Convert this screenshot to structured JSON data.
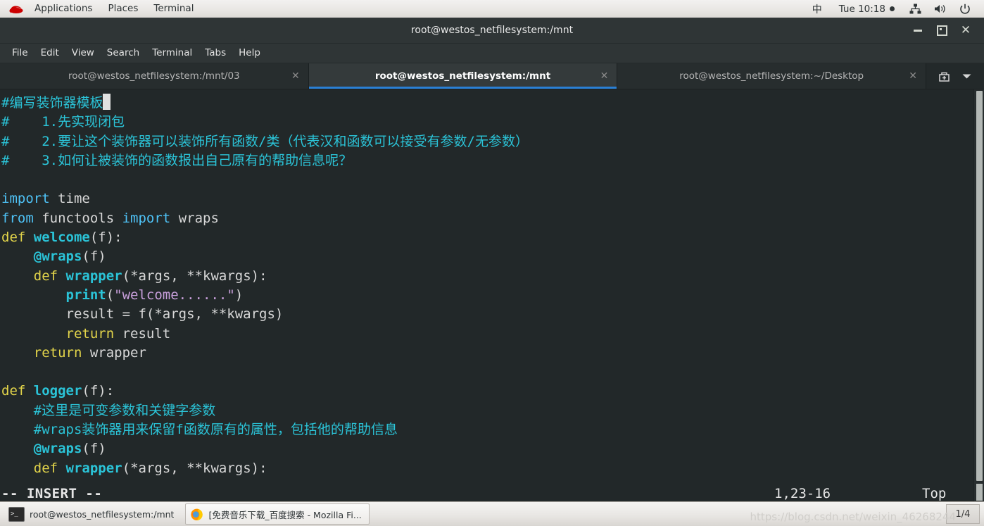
{
  "top_panel": {
    "logo_icon": "redhat-logo-icon",
    "menus": [
      "Applications",
      "Places",
      "Terminal"
    ],
    "ime": "中",
    "clock": "Tue 10:18",
    "icons": [
      "network-icon",
      "volume-icon",
      "power-icon"
    ]
  },
  "window": {
    "title": "root@westos_netfilesystem:/mnt",
    "controls": {
      "minimize": "minimize-icon",
      "maximize": "maximize-icon",
      "close": "close-icon"
    },
    "menubar": [
      "File",
      "Edit",
      "View",
      "Search",
      "Terminal",
      "Tabs",
      "Help"
    ],
    "tabs": [
      {
        "label": "root@westos_netfilesystem:/mnt/03",
        "active": false
      },
      {
        "label": "root@westos_netfilesystem:/mnt",
        "active": true
      },
      {
        "label": "root@westos_netfilesystem:~/Desktop",
        "active": false
      }
    ],
    "tab_actions": {
      "new_tab": "new-tab-icon",
      "tab_list": "chevron-down-icon"
    }
  },
  "terminal": {
    "lines": [
      [
        {
          "t": "#编写装饰器模板",
          "c": "c-comment"
        },
        {
          "t": "",
          "c": "cursor"
        }
      ],
      [
        {
          "t": "#    1.先实现闭包",
          "c": "c-comment"
        }
      ],
      [
        {
          "t": "#    2.要让这个装饰器可以装饰所有函数/类（代表汉和函数可以接受有参数/无参数）",
          "c": "c-comment"
        }
      ],
      [
        {
          "t": "#    3.如何让被装饰的函数报出自己原有的帮助信息呢？",
          "c": "c-comment"
        }
      ],
      [
        {
          "t": "",
          "c": "c-plain"
        }
      ],
      [
        {
          "t": "import",
          "c": "c-keyword"
        },
        {
          "t": " time",
          "c": "c-plain"
        }
      ],
      [
        {
          "t": "from",
          "c": "c-keyword"
        },
        {
          "t": " functools ",
          "c": "c-plain"
        },
        {
          "t": "import",
          "c": "c-keyword"
        },
        {
          "t": " wraps",
          "c": "c-plain"
        }
      ],
      [
        {
          "t": "def",
          "c": "c-def"
        },
        {
          "t": " ",
          "c": "c-plain"
        },
        {
          "t": "welcome",
          "c": "c-fn"
        },
        {
          "t": "(f):",
          "c": "c-plain"
        }
      ],
      [
        {
          "t": "    ",
          "c": "c-plain"
        },
        {
          "t": "@wraps",
          "c": "c-fn"
        },
        {
          "t": "(f)",
          "c": "c-plain"
        }
      ],
      [
        {
          "t": "    ",
          "c": "c-plain"
        },
        {
          "t": "def",
          "c": "c-def"
        },
        {
          "t": " ",
          "c": "c-plain"
        },
        {
          "t": "wrapper",
          "c": "c-fn"
        },
        {
          "t": "(*args, **kwargs):",
          "c": "c-plain"
        }
      ],
      [
        {
          "t": "        ",
          "c": "c-plain"
        },
        {
          "t": "print",
          "c": "c-fn"
        },
        {
          "t": "(",
          "c": "c-plain"
        },
        {
          "t": "\"welcome......\"",
          "c": "c-str"
        },
        {
          "t": ")",
          "c": "c-plain"
        }
      ],
      [
        {
          "t": "        result = f(*args, **kwargs)",
          "c": "c-plain"
        }
      ],
      [
        {
          "t": "        ",
          "c": "c-plain"
        },
        {
          "t": "return",
          "c": "c-def"
        },
        {
          "t": " result",
          "c": "c-plain"
        }
      ],
      [
        {
          "t": "    ",
          "c": "c-plain"
        },
        {
          "t": "return",
          "c": "c-def"
        },
        {
          "t": " wrapper",
          "c": "c-plain"
        }
      ],
      [
        {
          "t": "",
          "c": "c-plain"
        }
      ],
      [
        {
          "t": "def",
          "c": "c-def"
        },
        {
          "t": " ",
          "c": "c-plain"
        },
        {
          "t": "logger",
          "c": "c-fn"
        },
        {
          "t": "(f):",
          "c": "c-plain"
        }
      ],
      [
        {
          "t": "    #这里是可变参数和关键字参数",
          "c": "c-comment"
        }
      ],
      [
        {
          "t": "    #wraps装饰器用来保留f函数原有的属性，包括他的帮助信息",
          "c": "c-comment"
        }
      ],
      [
        {
          "t": "    ",
          "c": "c-plain"
        },
        {
          "t": "@wraps",
          "c": "c-fn"
        },
        {
          "t": "(f)",
          "c": "c-plain"
        }
      ],
      [
        {
          "t": "    ",
          "c": "c-plain"
        },
        {
          "t": "def",
          "c": "c-def"
        },
        {
          "t": " ",
          "c": "c-plain"
        },
        {
          "t": "wrapper",
          "c": "c-fn"
        },
        {
          "t": "(*args, **kwargs):",
          "c": "c-plain"
        }
      ]
    ],
    "status": {
      "mode": "-- INSERT --",
      "position": "1,23-16",
      "scroll": "Top"
    },
    "colors": {
      "background": "#222829",
      "comment": "#2bc4d8",
      "keyword": "#4fc3f7",
      "def": "#e2d44a",
      "function": "#2bc4d8",
      "string": "#c9a0dc",
      "plain": "#d8d8d8",
      "tab_accent": "#2a7fd4"
    }
  },
  "taskbar": {
    "items": [
      {
        "label": "root@westos_netfilesystem:/mnt",
        "icon": "terminal-icon",
        "boxed": false
      },
      {
        "label": "[免费音乐下载_百度搜索 - Mozilla Fi...",
        "icon": "firefox-icon",
        "boxed": true
      }
    ],
    "workspace": "1/4",
    "watermark": "https://blog.csdn.net/weixin_46268244"
  }
}
